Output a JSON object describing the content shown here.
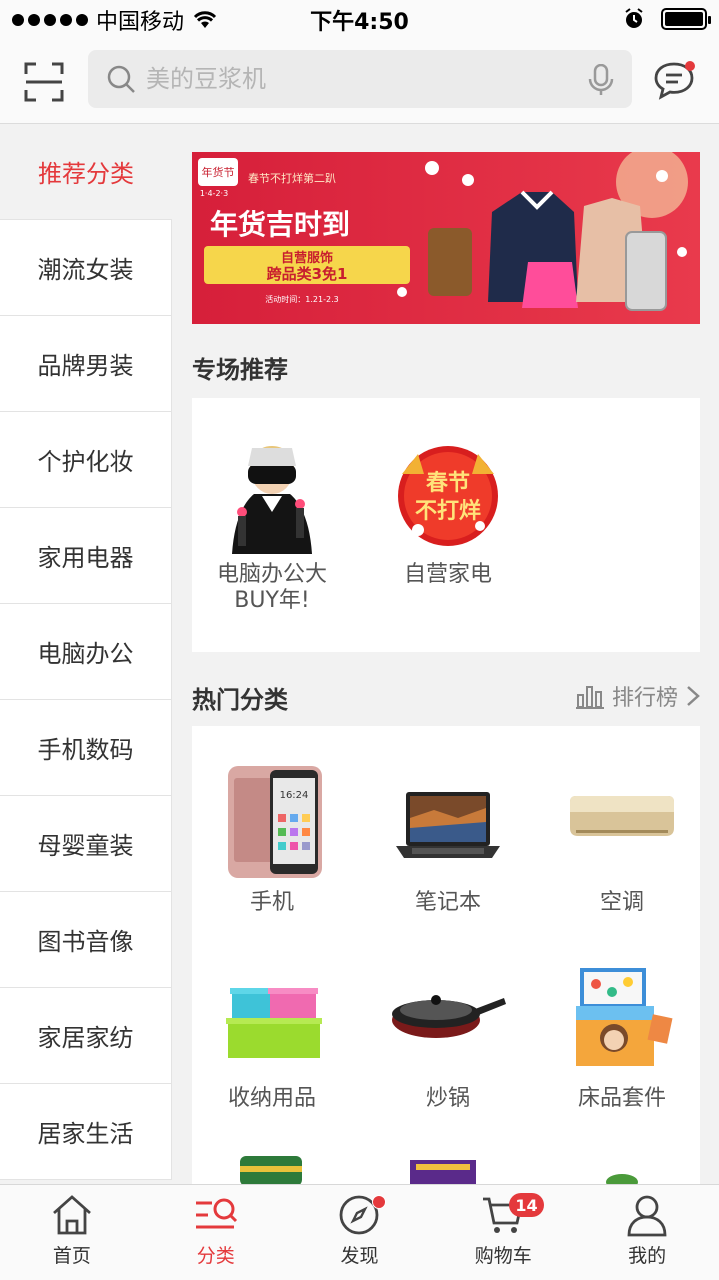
{
  "status_bar": {
    "carrier": "中国移动",
    "time": "下午4:50"
  },
  "search": {
    "placeholder": "美的豆浆机"
  },
  "sidebar": {
    "items": [
      {
        "label": "推荐分类"
      },
      {
        "label": "潮流女装"
      },
      {
        "label": "品牌男装"
      },
      {
        "label": "个护化妆"
      },
      {
        "label": "家用电器"
      },
      {
        "label": "电脑办公"
      },
      {
        "label": "手机数码"
      },
      {
        "label": "母婴童装"
      },
      {
        "label": "图书音像"
      },
      {
        "label": "家居家纺"
      },
      {
        "label": "居家生活"
      }
    ]
  },
  "banner": {
    "logo_text": "年货节",
    "logo_date": "1·4-2·3",
    "slogan": "春节不打烊第二趴",
    "headline": "年货吉时到",
    "sub_line1": "自营服饰",
    "sub_line2": "跨品类3免1",
    "date_text": "活动时间：1.21-2.3"
  },
  "special": {
    "title": "专场推荐",
    "items": [
      {
        "label": "电脑办公大BUY年!"
      },
      {
        "label": "自营家电",
        "badge_line1": "春节",
        "badge_line2": "不打烊"
      }
    ]
  },
  "hot": {
    "title": "热门分类",
    "rank_label": "排行榜",
    "items": [
      {
        "label": "手机"
      },
      {
        "label": "笔记本"
      },
      {
        "label": "空调"
      },
      {
        "label": "收纳用品"
      },
      {
        "label": "炒锅"
      },
      {
        "label": "床品套件"
      }
    ]
  },
  "tabbar": {
    "items": [
      {
        "label": "首页"
      },
      {
        "label": "分类"
      },
      {
        "label": "发现"
      },
      {
        "label": "购物车"
      },
      {
        "label": "我的"
      }
    ],
    "cart_count": "14"
  },
  "colors": {
    "accent": "#e4393c"
  }
}
